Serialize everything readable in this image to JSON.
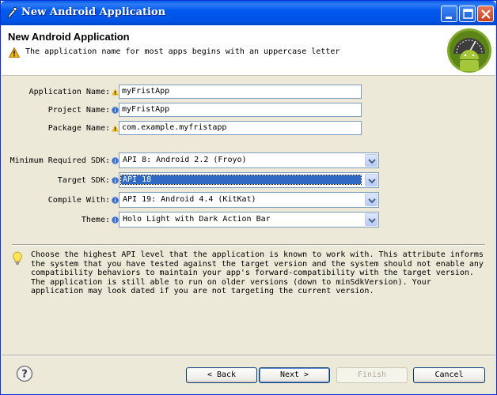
{
  "window": {
    "title": "New Android Application"
  },
  "header": {
    "title": "New Android Application",
    "message": "The application name for most apps begins with an uppercase letter"
  },
  "form": {
    "app_name": {
      "label": "Application Name:",
      "value": "myFristApp"
    },
    "project_name": {
      "label": "Project Name:",
      "value": "myFristApp"
    },
    "package_name": {
      "label": "Package Name:",
      "value": "com.example.myfristapp"
    },
    "min_sdk": {
      "label": "Minimum Required SDK:",
      "value": "API 8: Android 2.2 (Froyo)"
    },
    "target_sdk": {
      "label": "Target SDK:",
      "value": "API 18"
    },
    "compile_with": {
      "label": "Compile With:",
      "value": "API 19: Android 4.4 (KitKat)"
    },
    "theme": {
      "label": "Theme:",
      "value": "Holo Light with Dark Action Bar"
    }
  },
  "info": {
    "text": "Choose the highest API level that the application is known to work with. This attribute informs\nthe system that you have tested against the target version and the system should not enable any\ncompatibility behaviors to maintain your app's forward-compatibility with the target version.\nThe application is still able to run on older versions (down to minSdkVersion). Your\napplication may look dated if you are not targeting the current version."
  },
  "buttons": {
    "back": "< Back",
    "next": "Next >",
    "finish": "Finish",
    "cancel": "Cancel"
  },
  "colors": {
    "titlebar": "#0058ee",
    "selection": "#316ac5",
    "warning": "#f0b400",
    "info": "#3a6fd8",
    "android_green": "#a4c639"
  },
  "icons": {
    "title_icon": "eclipse-wizard-icon",
    "warning": "warning-icon",
    "info": "info-icon",
    "hint": "lightbulb-icon",
    "help": "help-icon",
    "logo": "android-logo-icon"
  }
}
